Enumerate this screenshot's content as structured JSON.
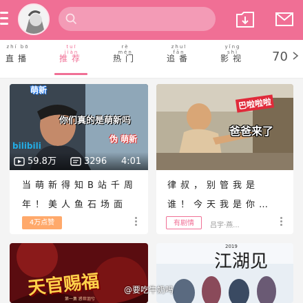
{
  "topbar": {
    "bg_color": "#f06f95",
    "icons": [
      "menu-icon",
      "search-icon",
      "download-icon",
      "mail-icon"
    ]
  },
  "tabs": [
    {
      "pinyin": "zhí bō",
      "label": "直播",
      "active": false
    },
    {
      "pinyin": "tuī jiàn",
      "label": "推荐",
      "active": true
    },
    {
      "pinyin": "rè mén",
      "label": "热门",
      "active": false
    },
    {
      "pinyin": "zhuī fān",
      "label": "追番",
      "active": false
    },
    {
      "pinyin": "yǐng shì",
      "label": "影视",
      "active": false
    }
  ],
  "tab_more": "70",
  "cards": [
    {
      "thumb_texts": {
        "badge": "萌新",
        "caption": "你们真的是萌新吗",
        "fake_badge": "伪 萌新",
        "logo": "bilibili"
      },
      "views": "59.8万",
      "danmaku": "3296",
      "duration": "4:01",
      "title_line1": "当萌新得知B站千周",
      "title_line2": "年！美人鱼石场面",
      "tag": "4万点赞"
    },
    {
      "thumb_texts": {
        "badge": "巴啦啦啦",
        "caption": "爸爸来了"
      },
      "title_line1": "律叔，别管我是",
      "title_line2": "谁！今天我是你…",
      "tag": "有剧情",
      "up_name": "吕宇·燕..."
    },
    {
      "thumb_texts": {
        "title": "天官赐福",
        "sub": "第一集 惑世羽兮"
      },
      "title_line1": "",
      "title_line2": ""
    },
    {
      "thumb_texts": {
        "title": "江湖见",
        "year": "2019"
      },
      "title_line1": "",
      "title_line2": ""
    }
  ],
  "watermark": "@要吃牛奶吗"
}
